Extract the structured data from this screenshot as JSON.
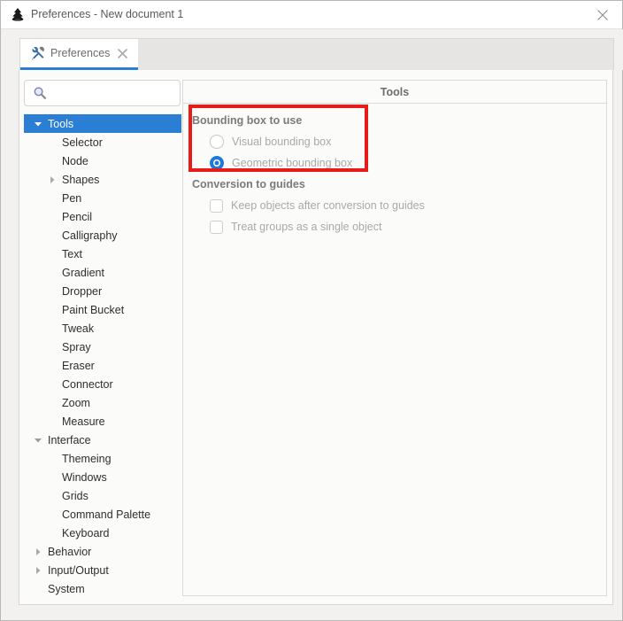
{
  "window": {
    "title": "Preferences - New document 1",
    "logo_icon": "inkscape-logo-icon",
    "close_icon": "close-icon"
  },
  "tabs": [
    {
      "label": "Preferences",
      "icon": "tools-icon",
      "close_icon": "tab-close-icon",
      "active": true
    }
  ],
  "sidebar": {
    "search": {
      "value": "",
      "placeholder": "",
      "icon": "search-icon"
    },
    "items": [
      {
        "label": "Tools",
        "indent": 0,
        "twisty": "down",
        "selected": true
      },
      {
        "label": "Selector",
        "indent": 1,
        "twisty": "none",
        "selected": false
      },
      {
        "label": "Node",
        "indent": 1,
        "twisty": "none",
        "selected": false
      },
      {
        "label": "Shapes",
        "indent": 1,
        "twisty": "right",
        "selected": false
      },
      {
        "label": "Pen",
        "indent": 1,
        "twisty": "none",
        "selected": false
      },
      {
        "label": "Pencil",
        "indent": 1,
        "twisty": "none",
        "selected": false
      },
      {
        "label": "Calligraphy",
        "indent": 1,
        "twisty": "none",
        "selected": false
      },
      {
        "label": "Text",
        "indent": 1,
        "twisty": "none",
        "selected": false
      },
      {
        "label": "Gradient",
        "indent": 1,
        "twisty": "none",
        "selected": false
      },
      {
        "label": "Dropper",
        "indent": 1,
        "twisty": "none",
        "selected": false
      },
      {
        "label": "Paint Bucket",
        "indent": 1,
        "twisty": "none",
        "selected": false
      },
      {
        "label": "Tweak",
        "indent": 1,
        "twisty": "none",
        "selected": false
      },
      {
        "label": "Spray",
        "indent": 1,
        "twisty": "none",
        "selected": false
      },
      {
        "label": "Eraser",
        "indent": 1,
        "twisty": "none",
        "selected": false
      },
      {
        "label": "Connector",
        "indent": 1,
        "twisty": "none",
        "selected": false
      },
      {
        "label": "Zoom",
        "indent": 1,
        "twisty": "none",
        "selected": false
      },
      {
        "label": "Measure",
        "indent": 1,
        "twisty": "none",
        "selected": false
      },
      {
        "label": "Interface",
        "indent": 0,
        "twisty": "down",
        "selected": false
      },
      {
        "label": "Themeing",
        "indent": 1,
        "twisty": "none",
        "selected": false
      },
      {
        "label": "Windows",
        "indent": 1,
        "twisty": "none",
        "selected": false
      },
      {
        "label": "Grids",
        "indent": 1,
        "twisty": "none",
        "selected": false
      },
      {
        "label": "Command Palette",
        "indent": 1,
        "twisty": "none",
        "selected": false
      },
      {
        "label": "Keyboard",
        "indent": 1,
        "twisty": "none",
        "selected": false
      },
      {
        "label": "Behavior",
        "indent": 0,
        "twisty": "right",
        "selected": false
      },
      {
        "label": "Input/Output",
        "indent": 0,
        "twisty": "right",
        "selected": false
      },
      {
        "label": "System",
        "indent": 0,
        "twisty": "none",
        "selected": false
      }
    ]
  },
  "panel": {
    "title": "Tools",
    "groups": [
      {
        "label": "Bounding box to use",
        "kind": "radio",
        "options": [
          {
            "label": "Visual bounding box",
            "checked": false
          },
          {
            "label": "Geometric bounding box",
            "checked": true
          }
        ]
      },
      {
        "label": "Conversion to guides",
        "kind": "checkbox",
        "options": [
          {
            "label": "Keep objects after conversion to guides",
            "checked": false
          },
          {
            "label": "Treat groups as a single object",
            "checked": false
          }
        ]
      }
    ]
  },
  "annotation": {
    "color": "#e81b1b",
    "target": "Bounding box to use"
  },
  "colors": {
    "selection_blue": "#2a7fd4",
    "radio_blue": "#1e7ad6",
    "annotation_red": "#e81b1b",
    "window_bg": "#f2f1f0",
    "panel_bg": "#fbfbfa"
  }
}
